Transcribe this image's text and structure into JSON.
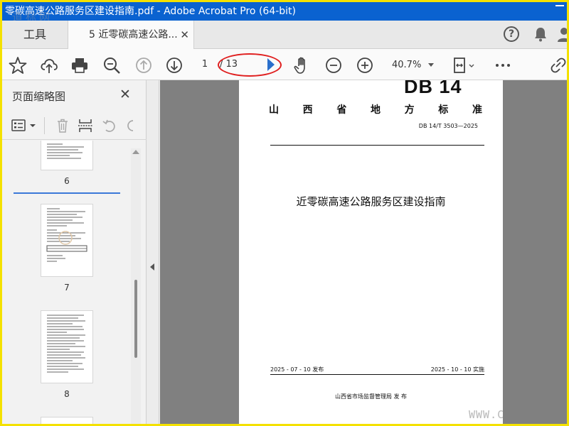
{
  "window": {
    "title": "零碳高速公路服务区建设指南.pdf - Adobe Acrobat Pro (64-bit)"
  },
  "watermark_text": "道标网",
  "web_watermark": "WWW.C",
  "tabs": {
    "tools_label": "工具",
    "doc_label": "5 近零碳高速公路...",
    "close_symbol": "✕"
  },
  "toolbar": {
    "page_current": "1",
    "page_total": "/ 13",
    "zoom": "40.7%",
    "help_symbol": "?"
  },
  "sidebar": {
    "title": "页面缩略图",
    "close_symbol": "✕",
    "pages": [
      {
        "label": "6"
      },
      {
        "label": "7"
      },
      {
        "label": "8"
      }
    ]
  },
  "document": {
    "logo": "DB 14",
    "standard_name_chars": [
      "山",
      "西",
      "省",
      "地",
      "方",
      "标",
      "准"
    ],
    "code": "DB 14/T 3503—2025",
    "title": "近零碳高速公路服务区建设指南",
    "issue_date": "2025 - 07 - 10 发布",
    "impl_date": "2025 - 10 - 10 实施",
    "issuer": "山西省市场监督管理局    发 布"
  },
  "colors": {
    "title_bar": "#0a62d0",
    "frame_border": "#f4e100",
    "annotation_ellipse": "#e02020",
    "accent": "#2a6fcc"
  }
}
